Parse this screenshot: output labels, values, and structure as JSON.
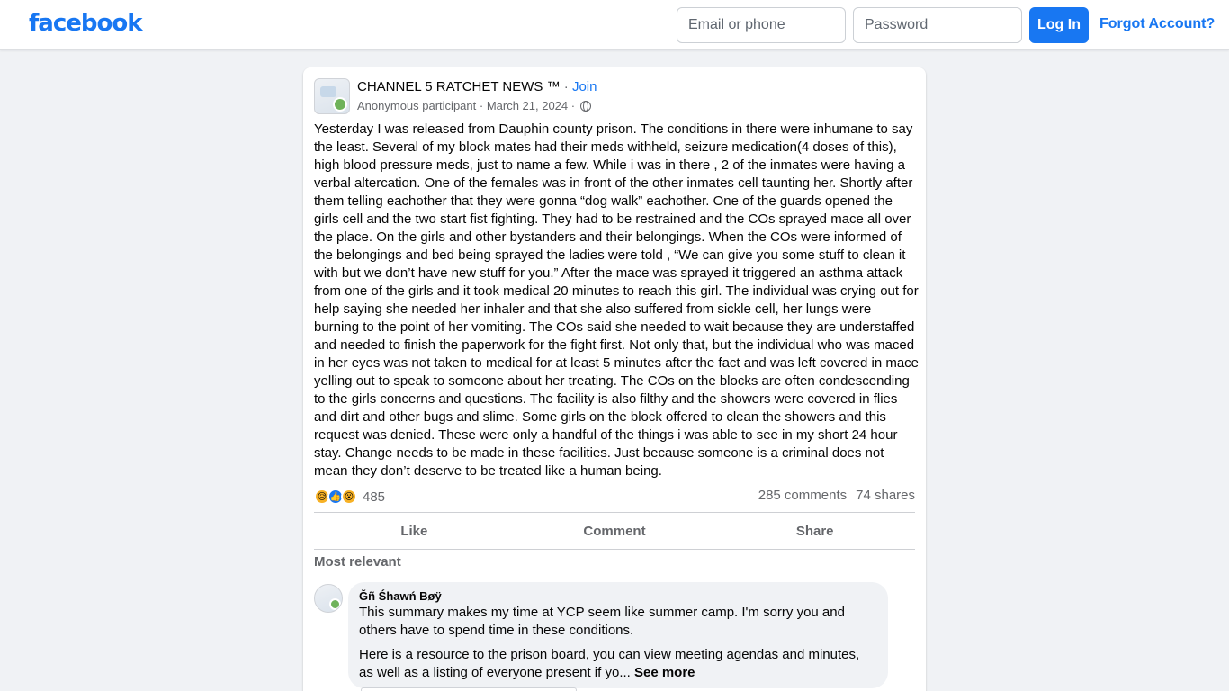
{
  "header": {
    "logo": "facebook",
    "email_placeholder": "Email or phone",
    "password_placeholder": "Password",
    "login_label": "Log In",
    "forgot_label": "Forgot Account?"
  },
  "post": {
    "group_name": "CHANNEL 5 RATCHET NEWS ™",
    "join_separator": " · ",
    "join_label": "Join",
    "author": "Anonymous participant",
    "date_separator": " · ",
    "date": "March 21, 2024",
    "privacy_separator": " · ",
    "privacy_icon": "globe-icon",
    "body": "Yesterday I was released from Dauphin county prison. The conditions in there were inhumane to say the least. Several of my block mates had their meds withheld, seizure medication(4 doses of this), high blood pressure meds, just to name a few. While i was in there , 2 of the inmates were having a verbal altercation. One of the females was in front of the other inmates cell taunting her. Shortly after them telling eachother that they were gonna “dog walk” eachother. One of the guards opened the girls cell and the two start fist fighting. They had to be restrained and the COs sprayed mace all over the place. On the girls and other bystanders and their belongings. When the COs were informed of the belongings and bed being sprayed the ladies were told , “We can give you some stuff to clean it with but we don’t have new stuff for you.” After the mace was sprayed it triggered an asthma attack from one of the girls and it took medical 20 minutes to reach this girl. The individual was crying out for help saying she needed her inhaler and that she also suffered from sickle cell, her lungs were burning to the point of her vomiting. The COs said she needed to wait because they are understaffed and needed to finish the paperwork for the fight first. Not only that, but the individual who was maced in her eyes was not taken to medical for at least 5 minutes after the fact and was left covered in mace yelling out to speak to someone about her treating. The COs on the blocks are often condescending to the girls concerns and questions. The facility is also filthy and the showers were covered in flies and dirt and other bugs and slime. Some girls on the block offered to clean the showers and this request was denied. These were only a handful of the things i was able to see in my short 24 hour stay. Change needs to be made in these facilities. Just because someone is a criminal does not mean they don’t deserve to be treated like a human being.",
    "reactions": {
      "icons": [
        "sad-icon",
        "like-icon",
        "wow-icon"
      ],
      "sad": "😥",
      "like": "👍",
      "wow": "😮",
      "count": "485"
    },
    "comments_count": "285 comments",
    "shares_count": "74 shares",
    "actions": {
      "like": "Like",
      "comment": "Comment",
      "share": "Share"
    }
  },
  "comments": {
    "sort_label": "Most relevant",
    "first": {
      "author": "Ğñ Śhawń Bøÿ",
      "text_1": "This summary makes my time at YCP seem like summer camp. I'm sorry you and others have to spend time in these conditions.",
      "text_2": "Here is a resource to the prison board, you can view meeting agendas and minutes, as well as a listing of everyone present if yo... ",
      "see_more": "See more"
    }
  },
  "colors": {
    "brand": "#1877f2",
    "background": "#f0f2f5",
    "secondary_text": "#65676b"
  }
}
